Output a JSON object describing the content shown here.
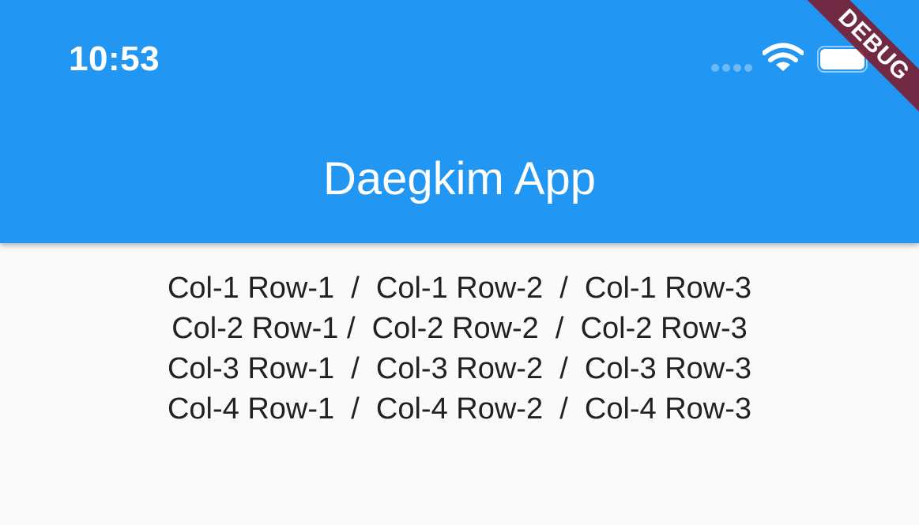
{
  "status_bar": {
    "time": "10:53"
  },
  "app_bar": {
    "title": "Daegkim App",
    "color": "#2196f3"
  },
  "debug_banner": {
    "label": "DEBUG",
    "color": "#7a1f34"
  },
  "content": {
    "rows": [
      "Col-1 Row-1  /  Col-1 Row-2  /  Col-1 Row-3",
      "Col-2 Row-1 /  Col-2 Row-2  /  Col-2 Row-3",
      "Col-3 Row-1  /  Col-3 Row-2  /  Col-3 Row-3",
      "Col-4 Row-1  /  Col-4 Row-2  /  Col-4 Row-3"
    ]
  }
}
